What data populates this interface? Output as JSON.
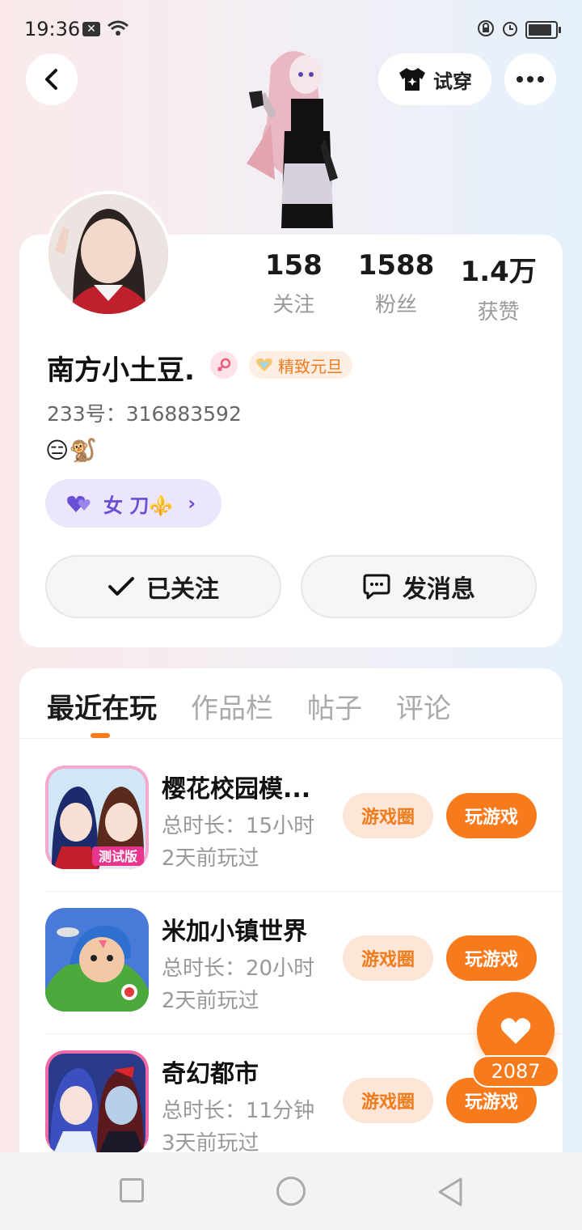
{
  "status_bar": {
    "time": "19:36",
    "x_badge": "✕"
  },
  "header": {
    "tryon_label": "试穿"
  },
  "profile": {
    "stats": [
      {
        "value": "158",
        "label": "关注"
      },
      {
        "value": "1588",
        "label": "粉丝"
      },
      {
        "value": "1.4万",
        "label": "获赞"
      }
    ],
    "nickname": "南方小土豆.",
    "medal_label": "精致元旦",
    "uid": "233号：316883592",
    "emojis": "😑🐒",
    "tag_label": "女 刀⚜️",
    "follow_label": "已关注",
    "message_label": "发消息"
  },
  "tabs": [
    {
      "label": "最近在玩",
      "active": true
    },
    {
      "label": "作品栏",
      "active": false
    },
    {
      "label": "帖子",
      "active": false
    },
    {
      "label": "评论",
      "active": false
    }
  ],
  "games": [
    {
      "name": "樱花校园模...",
      "duration": "总时长：15小时",
      "last_played": "2天前玩过",
      "circle_label": "游戏圈",
      "play_label": "玩游戏"
    },
    {
      "name": "米加小镇世界",
      "duration": "总时长：20小时",
      "last_played": "2天前玩过",
      "circle_label": "游戏圈",
      "play_label": "玩游戏"
    },
    {
      "name": "奇幻都市",
      "duration": "总时长：11分钟",
      "last_played": "3天前玩过",
      "circle_label": "游戏圈",
      "play_label": "玩游戏"
    }
  ],
  "like": {
    "count": "2087"
  },
  "colors": {
    "accent": "#f77a1d",
    "accent_light": "#fde5d8",
    "tag_bg": "#ebe6fb",
    "tag_text": "#6a4fd6"
  }
}
